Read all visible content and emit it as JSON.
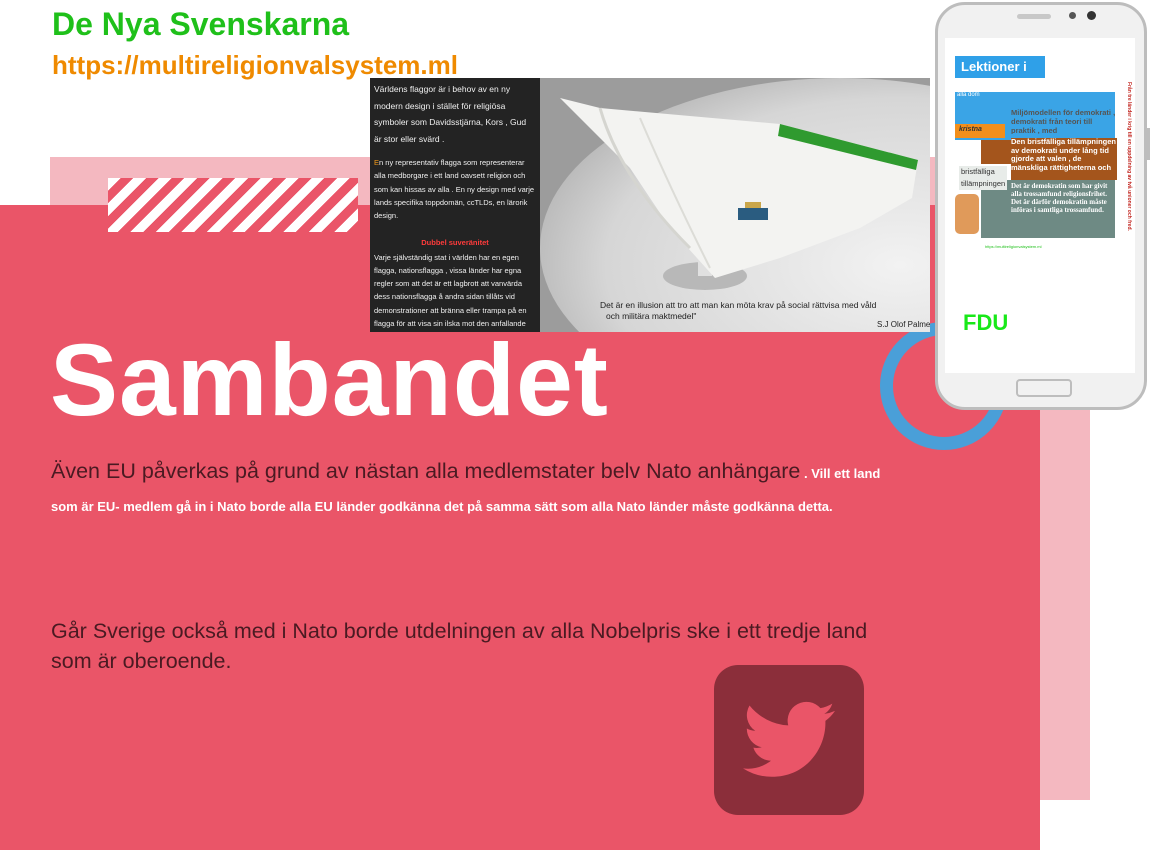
{
  "brand": {
    "title": "De Nya Svenskarna",
    "url": "https://multireligionvalsystem.ml"
  },
  "flag_panel": {
    "p1": "Världens flaggor är i behov av en ny modern design i stället för religiösa symboler som Davidsstjärna, Kors , Gud är stor eller svärd .",
    "p2_first": "E",
    "p2_rest": "n ny representativ flagga som representerar alla medborgare i ett land oavsett religion och som kan hissas av alla . En ny design med varje lands specifika toppdomän, ccTLDs, en lärorik design.",
    "section_title": "Dubbel suveränitet",
    "p3": "Varje självständig stat i världen har en egen flagga, nationsflagga , vissa länder har egna regler som att det är ett lagbrott att vanvärda dess nationsflagga å andra sidan tillåts vid demonstrationer  att bränna eller trampa på en flagga för att visa sin ilska mot den anfallande nationen t ex i krig eller vid ockupation."
  },
  "photo": {
    "quote_line1": "Det är en illusion att tro att man kan möta krav på social rättvisa med våld",
    "quote_line2": "och militära maktmedel\"",
    "quote_author": "S.J Olof Palme"
  },
  "main": {
    "heading": "Sambandet",
    "para1_large": "Även EU påverkas på grund av nästan alla medlemstater belv Nato anhängare",
    "para1_sep": " . ",
    "para1_small": "Vill ett land som är EU- medlem gå in i Nato borde alla EU länder godkänna det på samma sätt som alla Nato länder måste godkänna detta.",
    "para2": "Går Sverige också med i Nato borde utdelningen av alla Nobelpris ske i ett tredje land som är oberoende."
  },
  "phone_screen": {
    "title": "Lektioner i",
    "blue_sub": "alla dom",
    "t1": "Miljömodellen för demokrati , demokrati från teori till praktik , med Multireligionvalsystemet",
    "orange_label": "kristna",
    "t2": "Den bristfälliga tillämpningen av demokrati under lång tid gjorde att valen , de mänskliga rättigheterna och",
    "t3": "Det är demokratin som har givit alla trossamfund religionsfrihet. Det är därför demokratin måste införas i samtliga trossamfund.",
    "t4_line1": "bristfälliga",
    "t4_line2": "tillämpningen",
    "url": "https://multireligionvalsystem.ml",
    "fdu": "FDU",
    "vertical": "Från tre länder i krig till en uppdelning av två unioner och fred."
  },
  "icons": {
    "twitter": "twitter-bird-icon"
  },
  "colors": {
    "red_bg": "#ea5568",
    "pink_bg": "#f4b8c0",
    "green_title": "#1fc01a",
    "orange_url": "#ef8a00",
    "ring_blue": "#4a9fd8",
    "twitter_bg": "#8b2e3a"
  }
}
